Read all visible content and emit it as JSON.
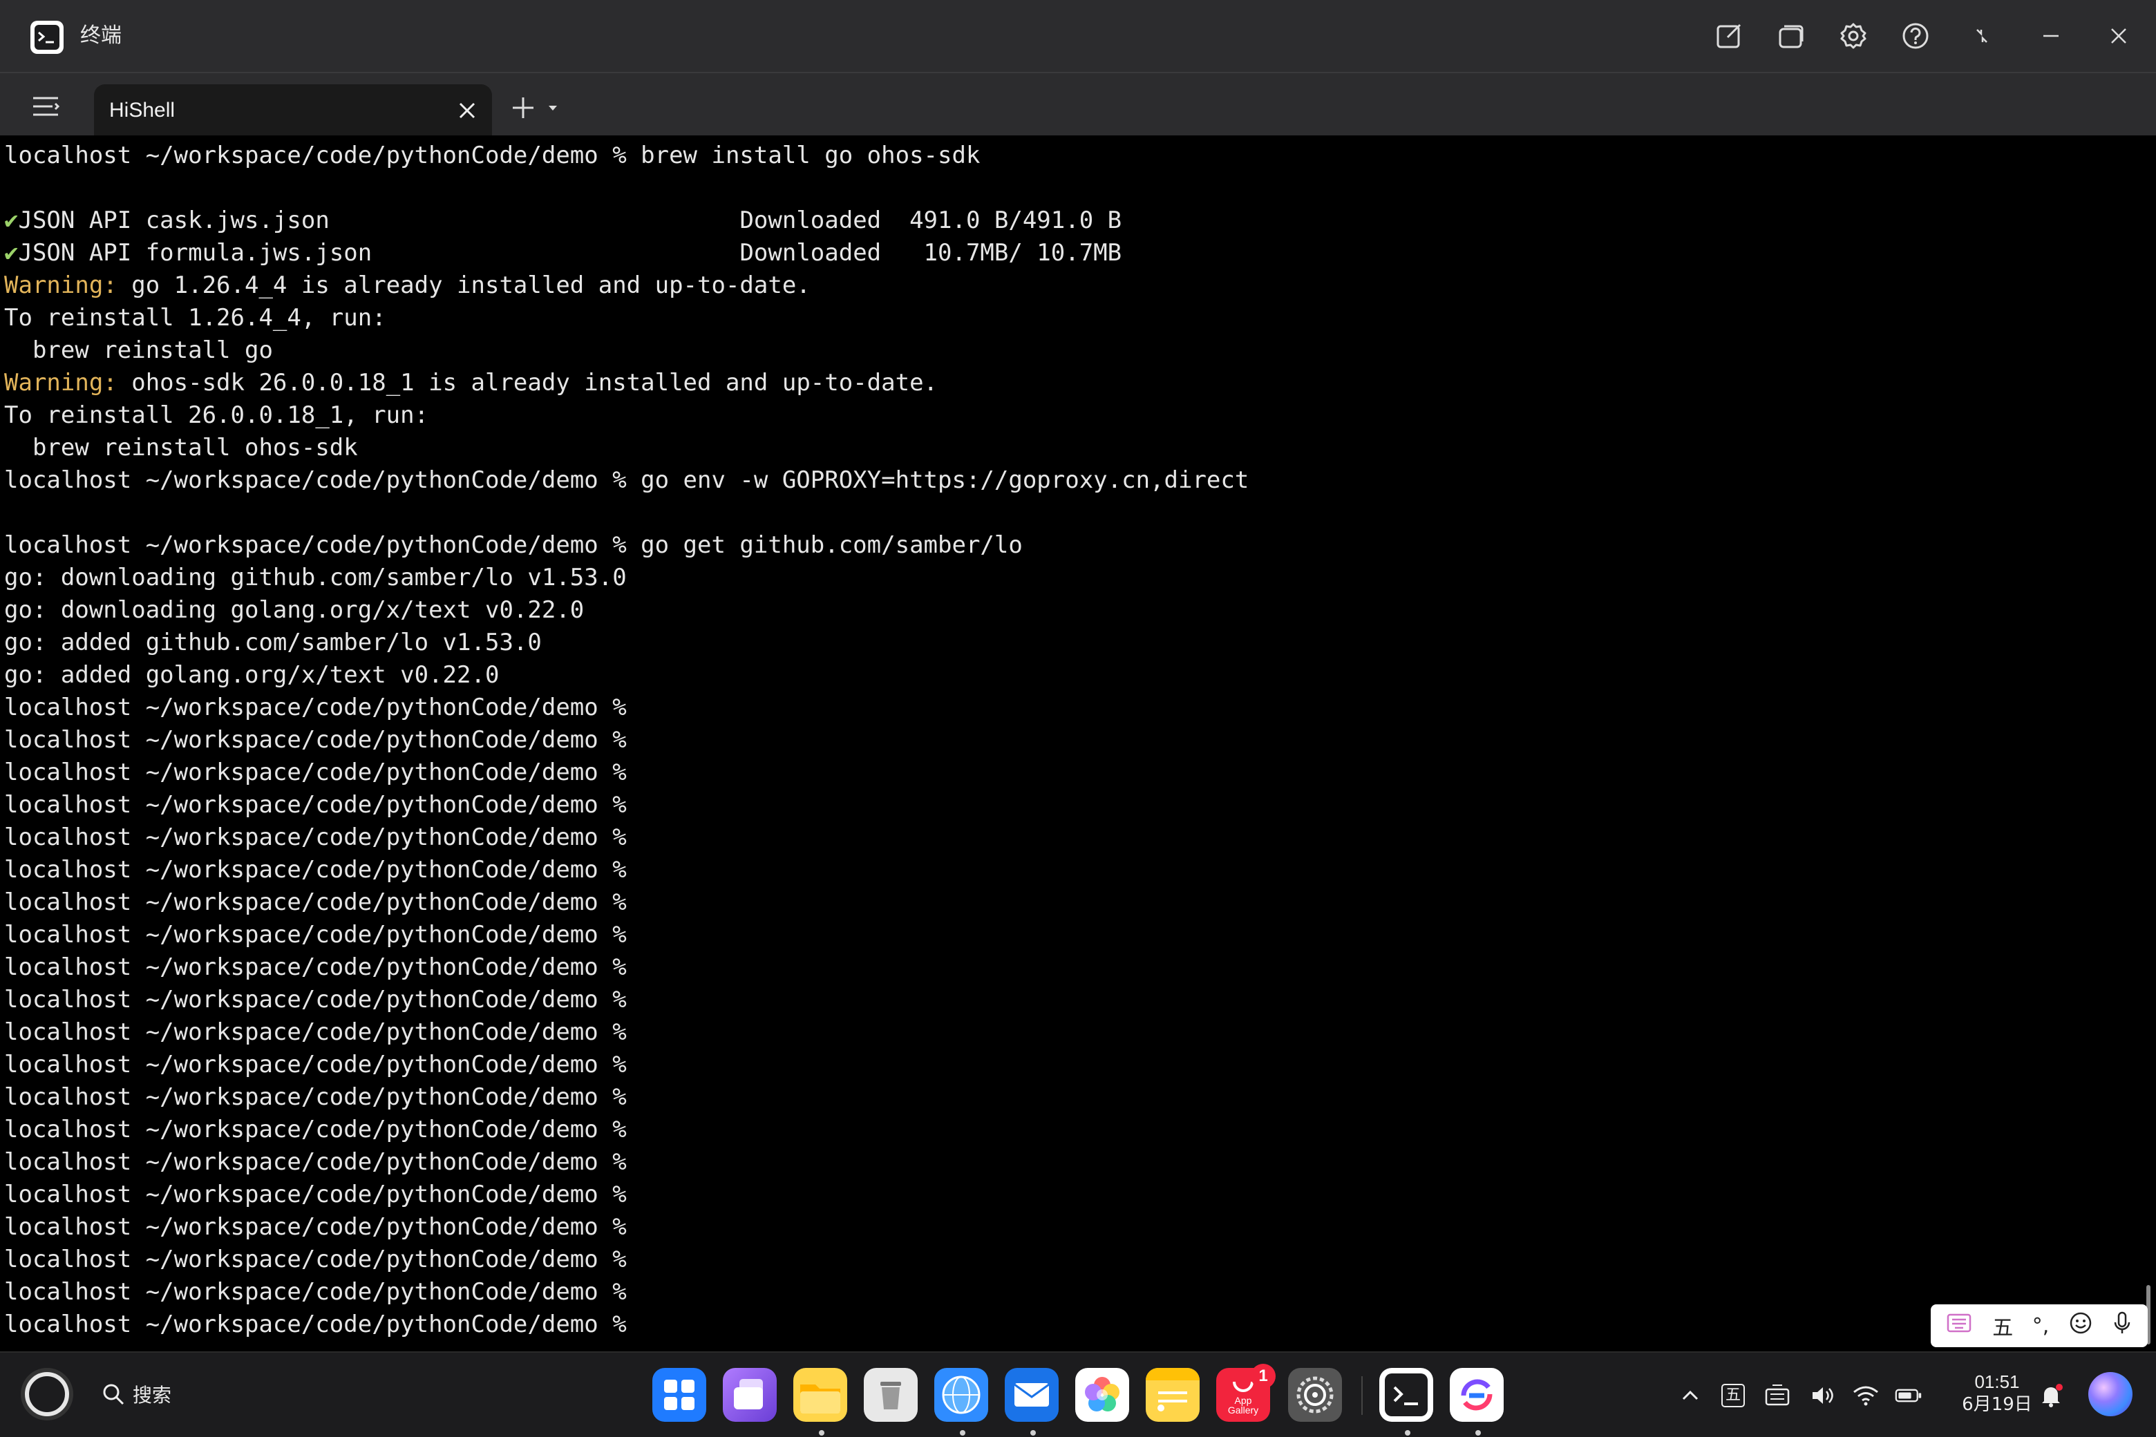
{
  "window": {
    "title": "终端"
  },
  "tabs": [
    {
      "label": "HiShell",
      "active": true
    }
  ],
  "terminal": {
    "lines": [
      {
        "type": "plain",
        "text": "localhost ~/workspace/code/pythonCode/demo % brew install go ohos-sdk"
      },
      {
        "type": "plain",
        "text": ""
      },
      {
        "type": "check",
        "mark": "✔",
        "text": "JSON API cask.jws.json                             Downloaded  491.0 B/491.0 B"
      },
      {
        "type": "check",
        "mark": "✔",
        "text": "JSON API formula.jws.json                          Downloaded   10.7MB/ 10.7MB"
      },
      {
        "type": "warn",
        "label": "Warning:",
        "text": " go 1.26.4_4 is already installed and up-to-date."
      },
      {
        "type": "plain",
        "text": "To reinstall 1.26.4_4, run:"
      },
      {
        "type": "plain",
        "text": "  brew reinstall go"
      },
      {
        "type": "warn",
        "label": "Warning:",
        "text": " ohos-sdk 26.0.0.18_1 is already installed and up-to-date."
      },
      {
        "type": "plain",
        "text": "To reinstall 26.0.0.18_1, run:"
      },
      {
        "type": "plain",
        "text": "  brew reinstall ohos-sdk"
      },
      {
        "type": "plain",
        "text": "localhost ~/workspace/code/pythonCode/demo % go env -w GOPROXY=https://goproxy.cn,direct"
      },
      {
        "type": "plain",
        "text": ""
      },
      {
        "type": "plain",
        "text": "localhost ~/workspace/code/pythonCode/demo % go get github.com/samber/lo"
      },
      {
        "type": "plain",
        "text": "go: downloading github.com/samber/lo v1.53.0"
      },
      {
        "type": "plain",
        "text": "go: downloading golang.org/x/text v0.22.0"
      },
      {
        "type": "plain",
        "text": "go: added github.com/samber/lo v1.53.0"
      },
      {
        "type": "plain",
        "text": "go: added golang.org/x/text v0.22.0"
      },
      {
        "type": "plain",
        "text": "localhost ~/workspace/code/pythonCode/demo %"
      },
      {
        "type": "plain",
        "text": "localhost ~/workspace/code/pythonCode/demo %"
      },
      {
        "type": "plain",
        "text": "localhost ~/workspace/code/pythonCode/demo %"
      },
      {
        "type": "plain",
        "text": "localhost ~/workspace/code/pythonCode/demo %"
      },
      {
        "type": "plain",
        "text": "localhost ~/workspace/code/pythonCode/demo %"
      },
      {
        "type": "plain",
        "text": "localhost ~/workspace/code/pythonCode/demo %"
      },
      {
        "type": "plain",
        "text": "localhost ~/workspace/code/pythonCode/demo %"
      },
      {
        "type": "plain",
        "text": "localhost ~/workspace/code/pythonCode/demo %"
      },
      {
        "type": "plain",
        "text": "localhost ~/workspace/code/pythonCode/demo %"
      },
      {
        "type": "plain",
        "text": "localhost ~/workspace/code/pythonCode/demo %"
      },
      {
        "type": "plain",
        "text": "localhost ~/workspace/code/pythonCode/demo %"
      },
      {
        "type": "plain",
        "text": "localhost ~/workspace/code/pythonCode/demo %"
      },
      {
        "type": "plain",
        "text": "localhost ~/workspace/code/pythonCode/demo %"
      },
      {
        "type": "plain",
        "text": "localhost ~/workspace/code/pythonCode/demo %"
      },
      {
        "type": "plain",
        "text": "localhost ~/workspace/code/pythonCode/demo %"
      },
      {
        "type": "plain",
        "text": "localhost ~/workspace/code/pythonCode/demo %"
      },
      {
        "type": "plain",
        "text": "localhost ~/workspace/code/pythonCode/demo %"
      },
      {
        "type": "plain",
        "text": "localhost ~/workspace/code/pythonCode/demo %"
      },
      {
        "type": "plain",
        "text": "localhost ~/workspace/code/pythonCode/demo %"
      },
      {
        "type": "plain",
        "text": "localhost ~/workspace/code/pythonCode/demo %"
      }
    ]
  },
  "ime": {
    "mode_label": "五",
    "punct_label": "°,"
  },
  "taskbar": {
    "search_label": "搜索",
    "badge_count": "1",
    "appgallery_label_1": "App",
    "appgallery_label_2": "Gallery",
    "tray_ime_label": "五",
    "time": "01:51",
    "date": "6月19日"
  },
  "colors": {
    "warning": "#e2b45a",
    "check": "#9cd36a",
    "titlebar": "#2c2c2e",
    "terminal_bg": "#000000"
  }
}
